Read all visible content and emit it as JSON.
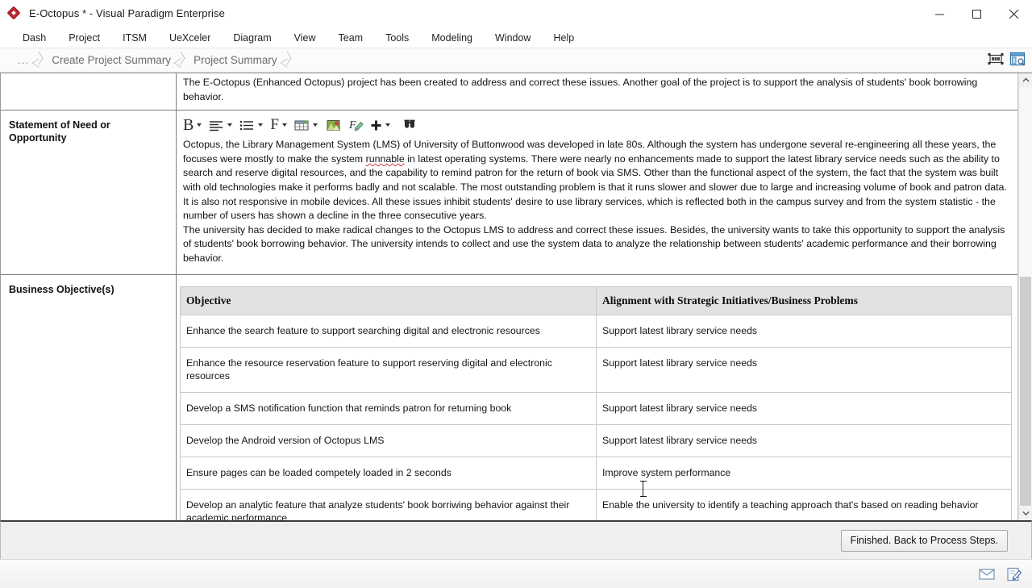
{
  "window": {
    "title": "E-Octopus * - Visual Paradigm Enterprise",
    "logo_icon": "vp-diamond-logo-icon",
    "minimize_label": "–",
    "maximize_label": "□",
    "close_label": "✕"
  },
  "menubar": {
    "items": [
      {
        "label": "Dash"
      },
      {
        "label": "Project"
      },
      {
        "label": "ITSM"
      },
      {
        "label": "UeXceler"
      },
      {
        "label": "Diagram"
      },
      {
        "label": "View"
      },
      {
        "label": "Team"
      },
      {
        "label": "Tools"
      },
      {
        "label": "Modeling"
      },
      {
        "label": "Window"
      },
      {
        "label": "Help"
      }
    ]
  },
  "breadcrumb": {
    "items": [
      {
        "label": "..."
      },
      {
        "label": "Create Project Summary"
      },
      {
        "label": "Project Summary"
      }
    ],
    "right_icons": [
      {
        "name": "fit-diagram-icon"
      },
      {
        "name": "open-preview-window-icon"
      }
    ]
  },
  "editor": {
    "top_paragraph": {
      "text": "The E-Octopus (Enhanced Octopus) project has been created to address and correct these issues. Another goal of the project is to support the analysis of students' book borrowing behavior."
    },
    "statement_section": {
      "label": "Statement of Need or Opportunity",
      "toolbar": [
        {
          "name": "bold-button",
          "label": "B",
          "has_dropdown": true
        },
        {
          "name": "paragraph-align-button",
          "label": "align",
          "has_dropdown": true
        },
        {
          "name": "bullet-list-button",
          "label": "list",
          "has_dropdown": true
        },
        {
          "name": "font-button",
          "label": "F",
          "has_dropdown": true
        },
        {
          "name": "insert-table-button",
          "label": "table",
          "has_dropdown": true
        },
        {
          "name": "insert-image-button",
          "label": "image",
          "has_dropdown": false
        },
        {
          "name": "format-painter-button",
          "label": "format-painter",
          "has_dropdown": false
        },
        {
          "name": "insert-button",
          "label": "+",
          "has_dropdown": true
        },
        {
          "name": "find-button",
          "label": "find",
          "has_dropdown": false
        }
      ],
      "paragraphs": [
        {
          "pre": "Octopus, the Library Management System (LMS) of University of Buttonwood was developed in late 80s. Although the system has undergone several re-engineering all these years, the focuses were mostly to make the system ",
          "misspelled": "runnable",
          "post": " in latest operating systems. There were nearly no enhancements made to support the latest library service needs such as the ability to search and reserve digital resources, and the capability to remind patron for the return of book via SMS. Other than the functional aspect of the system, the fact that the system was built with old technologies make it performs badly and not scalable. The most outstanding problem is that it runs slower and slower due to large and increasing volume of book and patron data. It is also not responsive in mobile devices. All these issues inhibit students' desire to use library services, which is reflected both in the campus survey and from the system statistic - the number of users has shown a decline in the three consecutive years."
        },
        {
          "text": "The university has decided to make radical changes to the Octopus LMS to address and correct these issues. Besides, the university wants to take this opportunity to support the analysis of students' book borrowing behavior. The university intends to collect and use the system data to analyze the relationship between students' academic performance and their borrowing behavior."
        }
      ]
    },
    "business_objectives_section": {
      "label": "Business Objective(s)",
      "table": {
        "columns": [
          "Objective",
          "Alignment with Strategic Initiatives/Business Problems"
        ],
        "rows": [
          [
            "Enhance the search feature to support searching digital and electronic resources",
            "Support latest library service needs"
          ],
          [
            "Enhance the resource reservation feature to support reserving digital and electronic resources",
            "Support latest library service needs"
          ],
          [
            "Develop a SMS notification function that reminds patron for returning book",
            "Support latest library service needs"
          ],
          [
            "Develop the Android version of Octopus LMS",
            "Support latest library service needs"
          ],
          [
            "Ensure pages can be loaded competely loaded in 2 seconds",
            "Improve system performance"
          ],
          [
            "Develop an analytic feature that analyze students' book borriwing behavior against their academic performance",
            "Enable the university to identify a teaching approach that's based on reading behavior"
          ]
        ]
      }
    },
    "scrollbar": {
      "up_arrow": "▲",
      "down_arrow": "▼"
    }
  },
  "footer": {
    "finish_button": "Finished. Back to Process Steps."
  },
  "statusbar": {
    "icons": [
      {
        "name": "message-envelope-icon"
      },
      {
        "name": "edit-note-icon"
      }
    ]
  },
  "colors": {
    "accent_red": "#c0272d",
    "table_header_bg": "#e2e2e2",
    "spellcheck_underline": "#d33c3c"
  }
}
